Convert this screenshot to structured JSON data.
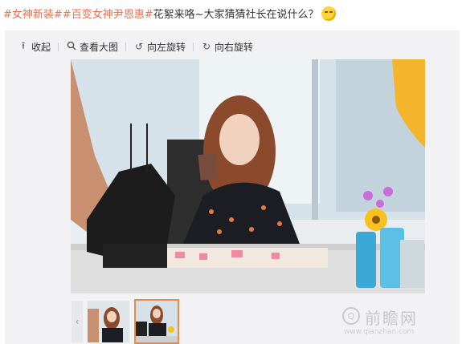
{
  "post": {
    "hashtags": [
      "#女神新装#",
      "#百变女神尹恩惠#"
    ],
    "text": "花絮来咯~大家猜猜社长在说什么？",
    "emoji": "smirk-emoji"
  },
  "toolbar": {
    "collapse_label": "收起",
    "view_large_label": "查看大图",
    "rotate_left_label": "向左旋转",
    "rotate_right_label": "向右旋转"
  },
  "thumbnails": {
    "prev_icon": "‹",
    "selected_index": 1,
    "count": 2
  },
  "watermark": {
    "logo_text": "Q",
    "name": "前瞻网",
    "url": "www.qianzhan.com"
  },
  "colors": {
    "hashtag": "#eb7350",
    "selected_thumb_border": "#f18a3f"
  }
}
